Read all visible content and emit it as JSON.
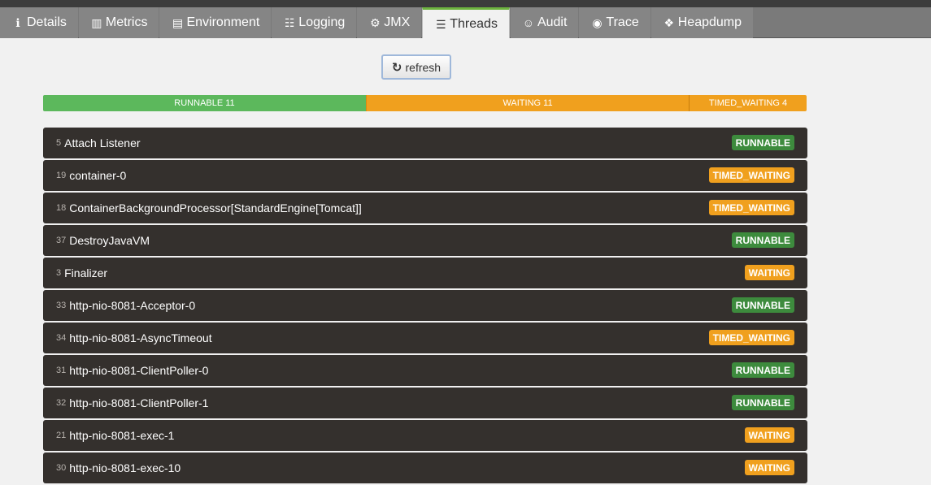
{
  "tabs": [
    {
      "label": "Details",
      "icon": "info-icon",
      "glyph": "ℹ",
      "active": false
    },
    {
      "label": "Metrics",
      "icon": "bar-chart-icon",
      "glyph": "▥",
      "active": false
    },
    {
      "label": "Environment",
      "icon": "table-icon",
      "glyph": "▤",
      "active": false
    },
    {
      "label": "Logging",
      "icon": "sliders-icon",
      "glyph": "☷",
      "active": false
    },
    {
      "label": "JMX",
      "icon": "gears-icon",
      "glyph": "⚙",
      "active": false
    },
    {
      "label": "Threads",
      "icon": "list-icon",
      "glyph": "☰",
      "active": true
    },
    {
      "label": "Audit",
      "icon": "user-circle-icon",
      "glyph": "☺",
      "active": false
    },
    {
      "label": "Trace",
      "icon": "eye-icon",
      "glyph": "◉",
      "active": false
    },
    {
      "label": "Heapdump",
      "icon": "cubes-icon",
      "glyph": "❖",
      "active": false
    }
  ],
  "refresh": {
    "label": "refresh",
    "icon": "refresh-icon",
    "glyph": "↻"
  },
  "summary": {
    "runnable": {
      "label": "RUNNABLE 11",
      "count": 11
    },
    "waiting": {
      "label": "WAITING 11",
      "count": 11
    },
    "timed_waiting": {
      "label": "TIMED_WAITING 4",
      "count": 4
    }
  },
  "threads": [
    {
      "id": "5",
      "name": "Attach Listener",
      "state": "RUNNABLE"
    },
    {
      "id": "19",
      "name": "container-0",
      "state": "TIMED_WAITING"
    },
    {
      "id": "18",
      "name": "ContainerBackgroundProcessor[StandardEngine[Tomcat]]",
      "state": "TIMED_WAITING"
    },
    {
      "id": "37",
      "name": "DestroyJavaVM",
      "state": "RUNNABLE"
    },
    {
      "id": "3",
      "name": "Finalizer",
      "state": "WAITING"
    },
    {
      "id": "33",
      "name": "http-nio-8081-Acceptor-0",
      "state": "RUNNABLE"
    },
    {
      "id": "34",
      "name": "http-nio-8081-AsyncTimeout",
      "state": "TIMED_WAITING"
    },
    {
      "id": "31",
      "name": "http-nio-8081-ClientPoller-0",
      "state": "RUNNABLE"
    },
    {
      "id": "32",
      "name": "http-nio-8081-ClientPoller-1",
      "state": "RUNNABLE"
    },
    {
      "id": "21",
      "name": "http-nio-8081-exec-1",
      "state": "WAITING"
    },
    {
      "id": "30",
      "name": "http-nio-8081-exec-10",
      "state": "WAITING"
    }
  ],
  "colors": {
    "runnable": "#5cb85c",
    "waiting": "#f0a01e",
    "row_bg": "#34302d",
    "active_tab_accent": "#6db33f"
  }
}
